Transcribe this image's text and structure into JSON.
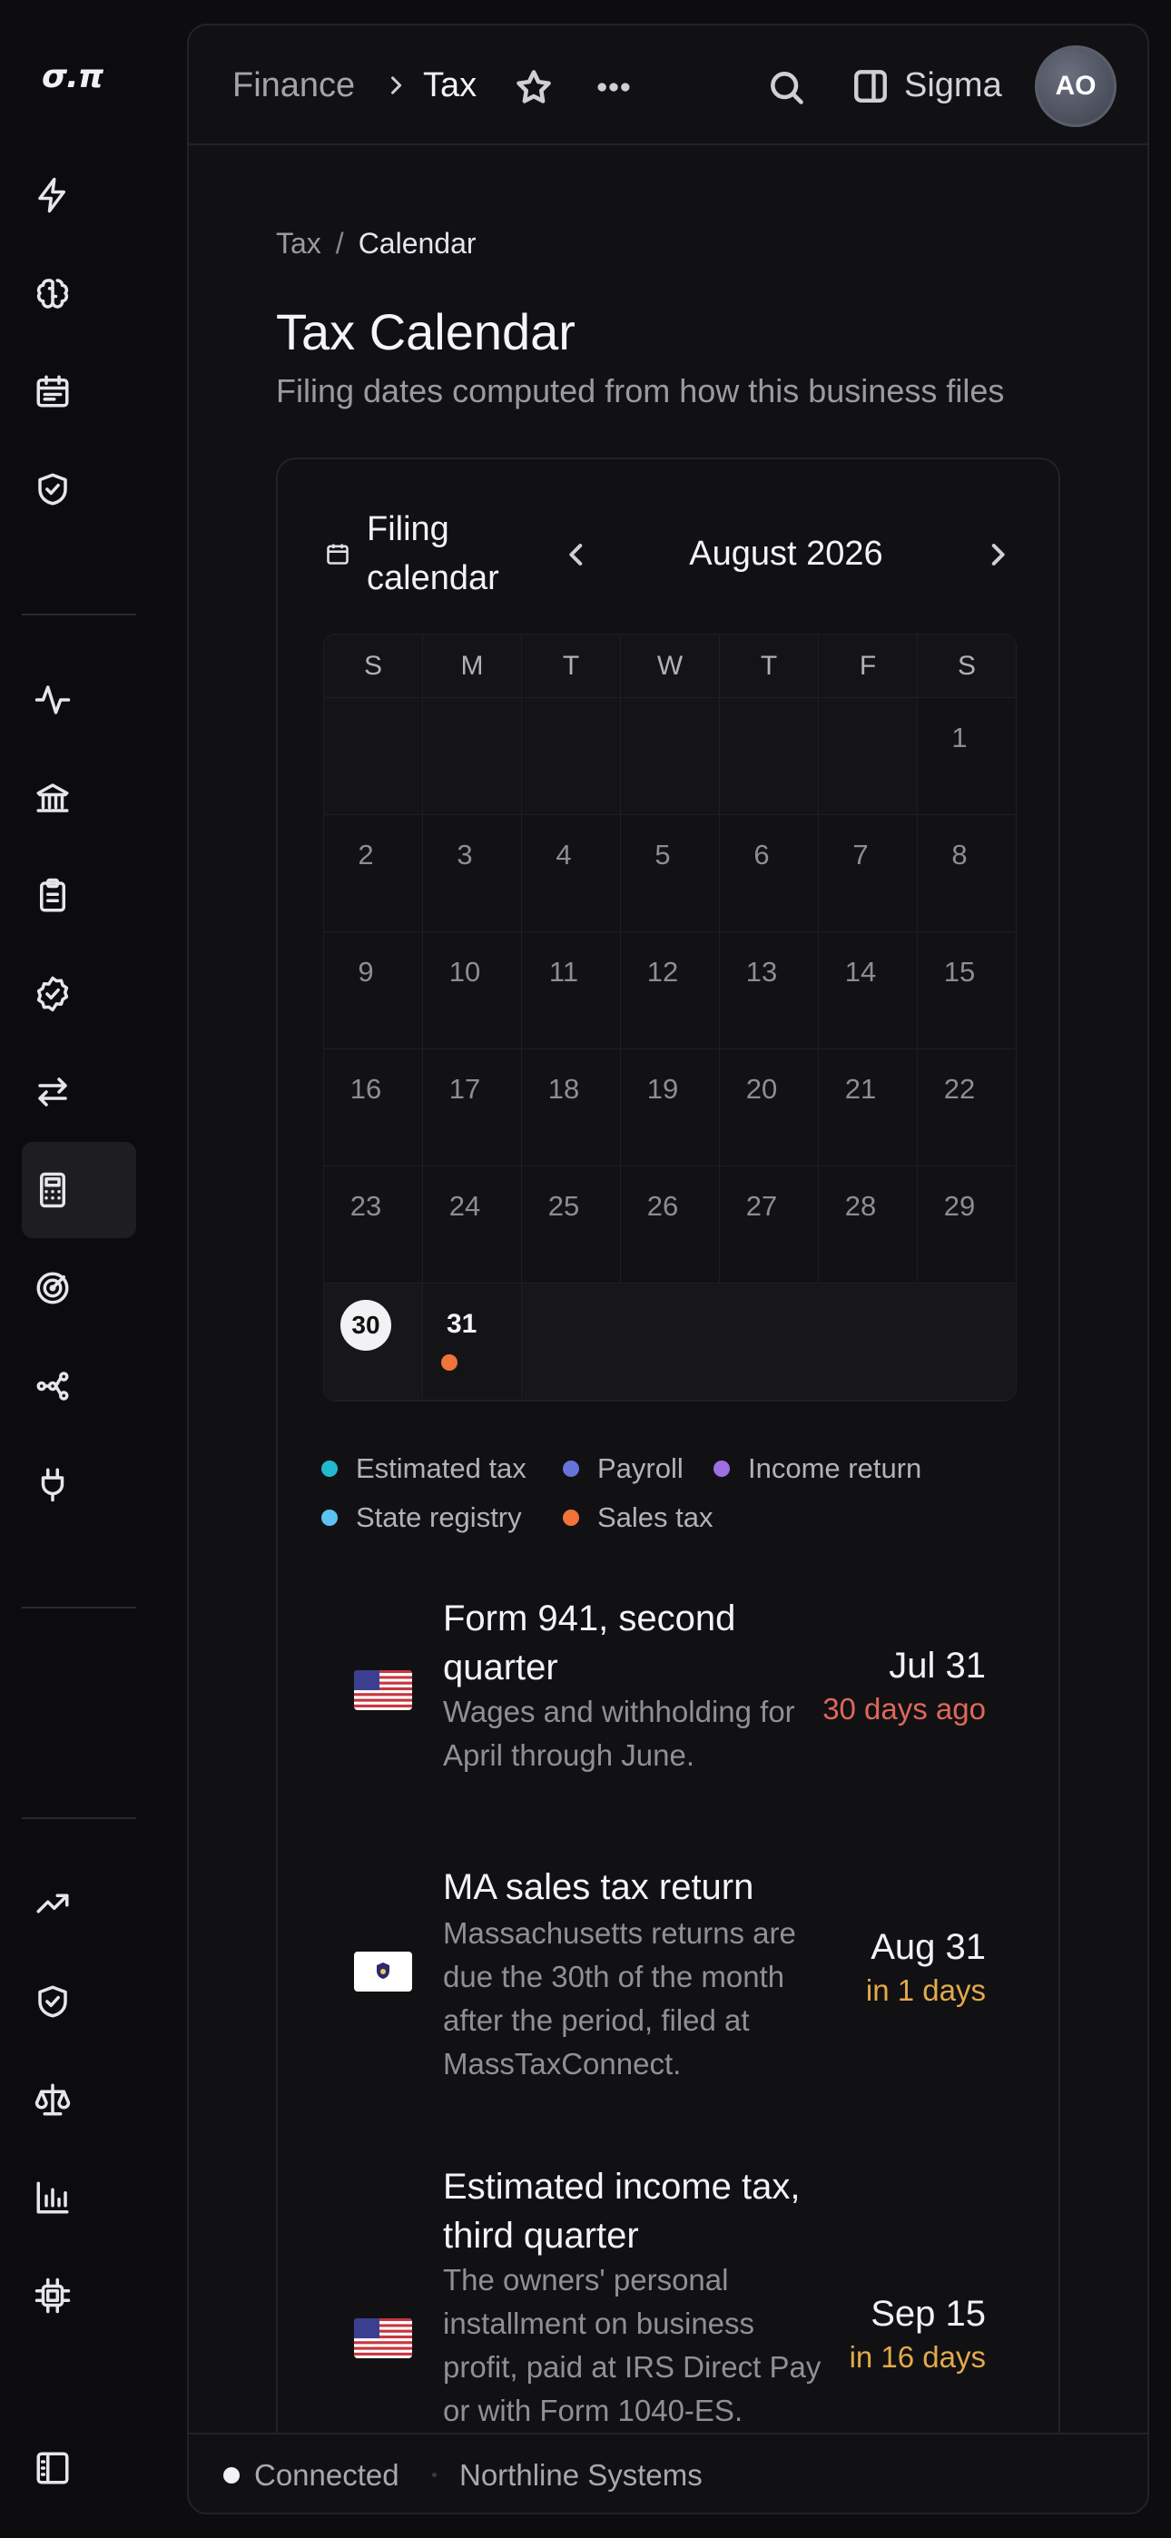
{
  "app": {
    "logo": "σ.π"
  },
  "sidebar": {
    "items": [
      {
        "icon": "bolt-icon"
      },
      {
        "icon": "brain-icon"
      },
      {
        "icon": "calendar-list-icon"
      },
      {
        "icon": "shield-check-icon"
      },
      {
        "icon": "activity-icon"
      },
      {
        "icon": "bank-icon"
      },
      {
        "icon": "clipboard-icon"
      },
      {
        "icon": "badge-check-icon"
      },
      {
        "icon": "arrows-swap-icon"
      },
      {
        "icon": "calculator-icon",
        "active": true
      },
      {
        "icon": "target-icon"
      },
      {
        "icon": "workflow-icon"
      },
      {
        "icon": "plug-icon"
      },
      {
        "icon": "trending-up-icon"
      },
      {
        "icon": "shield-check-icon"
      },
      {
        "icon": "scale-icon"
      },
      {
        "icon": "bar-chart-icon"
      },
      {
        "icon": "chip-icon"
      },
      {
        "icon": "panel-icon"
      }
    ]
  },
  "header": {
    "breadcrumb_root": "Finance",
    "breadcrumb_current": "Tax",
    "workspace": "Sigma",
    "avatar_initials": "AO"
  },
  "page": {
    "breadcrumb_parent": "Tax",
    "breadcrumb_separator": "/",
    "breadcrumb_current": "Calendar",
    "title": "Tax Calendar",
    "subtitle": "Filing dates computed from how this business files"
  },
  "calendar": {
    "title": "Filing calendar",
    "month": "August 2026",
    "weekdays": [
      "S",
      "M",
      "T",
      "W",
      "T",
      "F",
      "S"
    ],
    "leading_blank_days": 6,
    "days_in_month": 31,
    "today": 30,
    "events": [
      {
        "day": 31,
        "category": "Sales tax",
        "color": "#f0733c"
      }
    ]
  },
  "legend": [
    {
      "label": "Estimated tax",
      "color": "#22b8cf"
    },
    {
      "label": "Payroll",
      "color": "#6872d8"
    },
    {
      "label": "Income return",
      "color": "#9d6fe0"
    },
    {
      "label": "State registry",
      "color": "#5cc2f2"
    },
    {
      "label": "Sales tax",
      "color": "#f0733c"
    }
  ],
  "deadlines": [
    {
      "flag": "us-flag",
      "title": "Form 941, second quarter",
      "description": "Wages and withholding for April through June.",
      "date": "Jul 31",
      "relative": "30 days ago",
      "relative_color": "#e0675a"
    },
    {
      "flag": "massachusetts-flag",
      "title": "MA sales tax return",
      "description": "Massachusetts returns are due the 30th of the month after the period, filed at MassTaxConnect.",
      "date": "Aug 31",
      "relative": "in 1 days",
      "relative_color": "#e3a94b"
    },
    {
      "flag": "us-flag",
      "title": "Estimated income tax, third quarter",
      "description": "The owners' personal installment on business profit, paid at IRS Direct Pay or with Form 1040-ES.",
      "date": "Sep 15",
      "relative": "in 16 days",
      "relative_color": "#e3a94b"
    }
  ],
  "footer": {
    "status": "Connected",
    "organization": "Northline Systems"
  }
}
